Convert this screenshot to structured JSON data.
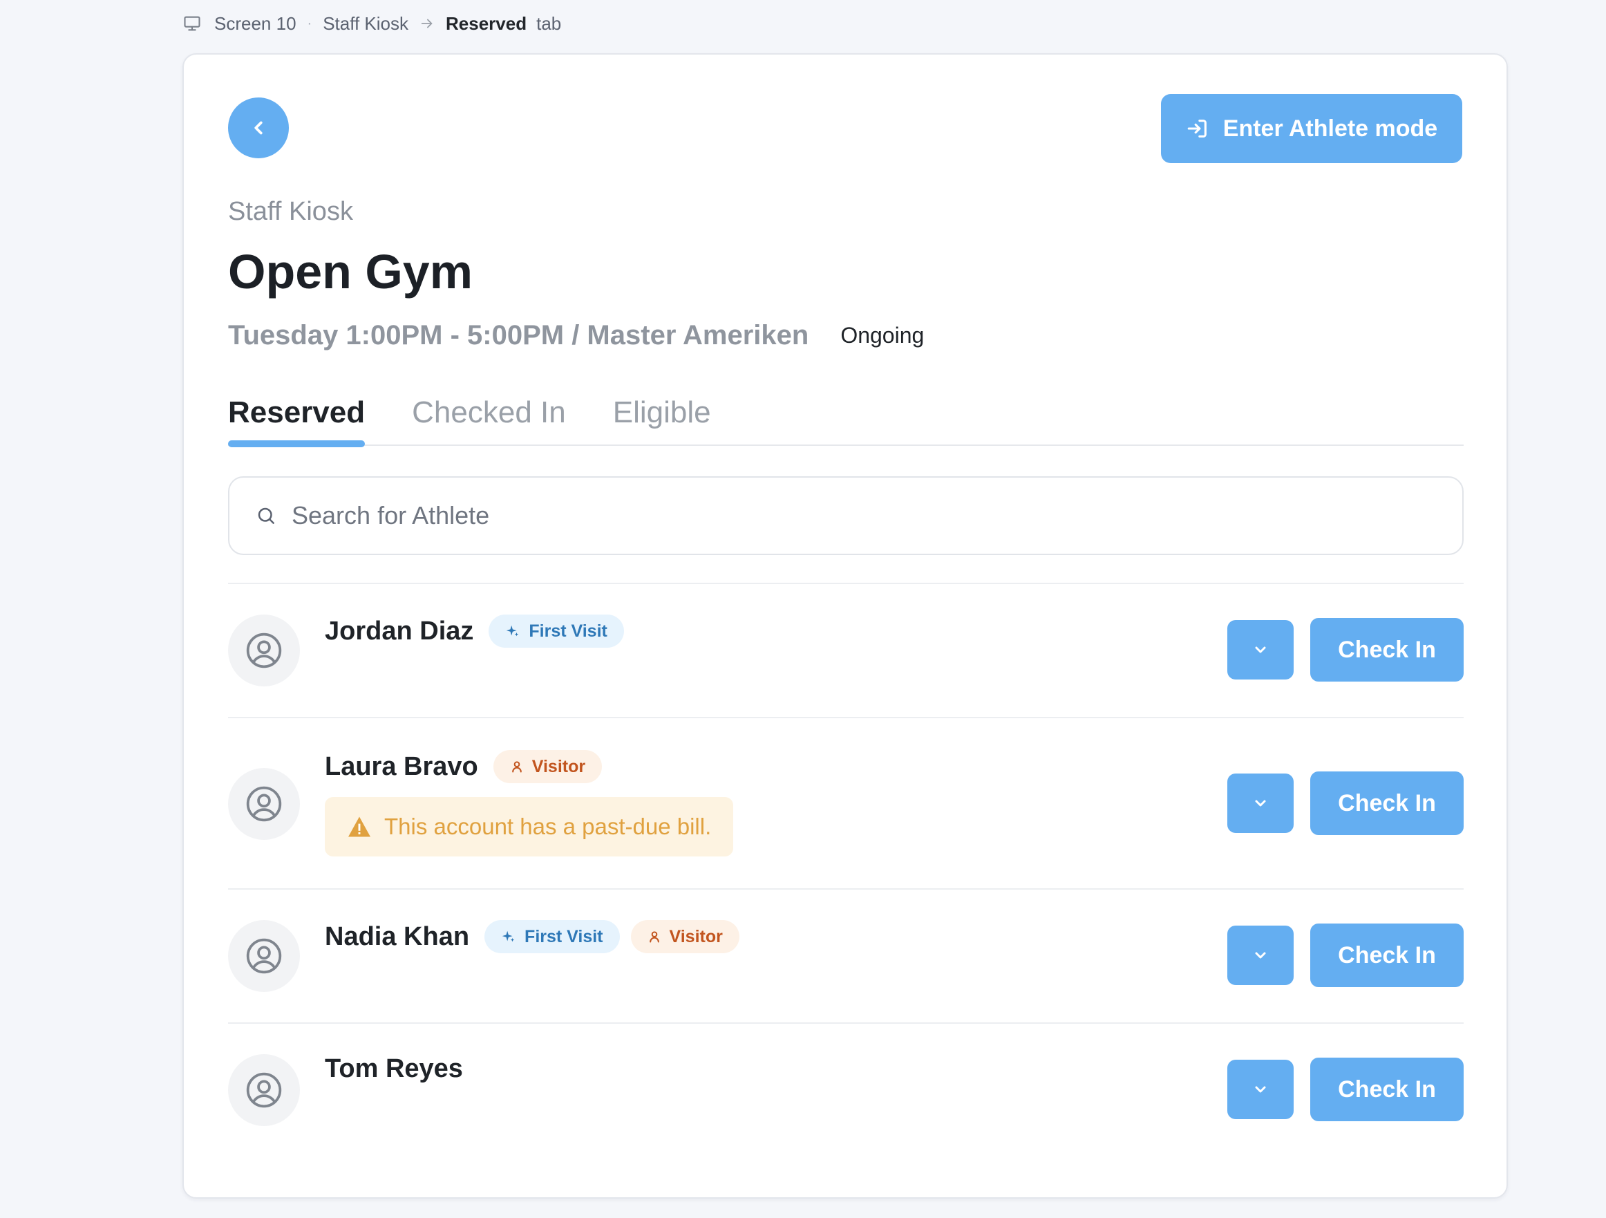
{
  "breadcrumb": {
    "screen": "Screen 10",
    "section": "Staff Kiosk",
    "current": "Reserved",
    "suffix": "tab"
  },
  "header": {
    "athlete_mode_label": "Enter Athlete mode",
    "eyebrow": "Staff Kiosk",
    "title": "Open Gym",
    "schedule": "Tuesday 1:00PM - 5:00PM / Master Ameriken",
    "status": "Ongoing"
  },
  "tabs": [
    {
      "label": "Reserved",
      "active": true
    },
    {
      "label": "Checked In",
      "active": false
    },
    {
      "label": "Eligible",
      "active": false
    }
  ],
  "search": {
    "placeholder": "Search for Athlete"
  },
  "athletes": [
    {
      "name": "Jordan Diaz",
      "badges": [
        "First Visit"
      ],
      "alert": "",
      "checkin_label": "Check In"
    },
    {
      "name": "Laura Bravo",
      "badges": [
        "Visitor"
      ],
      "alert": "This account has a past-due bill.",
      "checkin_label": "Check In"
    },
    {
      "name": "Nadia Khan",
      "badges": [
        "First Visit",
        "Visitor"
      ],
      "alert": "",
      "checkin_label": "Check In"
    },
    {
      "name": "Tom Reyes",
      "badges": [],
      "alert": "",
      "checkin_label": "Check In"
    }
  ],
  "icons": {
    "breadcrumb": "monitor-icon",
    "back": "chevron-left-icon",
    "athlete_mode": "sign-in-icon",
    "search": "search-icon",
    "avatar": "user-circle-icon",
    "first_visit": "sparkle-icon",
    "visitor": "user-icon",
    "alert": "warning-icon",
    "more": "chevron-down-icon"
  },
  "colors": {
    "accent": "#64aef1",
    "first_visit_bg": "#e6f3fd",
    "first_visit_text": "#2e78b7",
    "visitor_bg": "#fdf1e6",
    "visitor_text": "#c2551f",
    "alert_bg": "#fdf3e1",
    "alert_text": "#e0a13f"
  }
}
